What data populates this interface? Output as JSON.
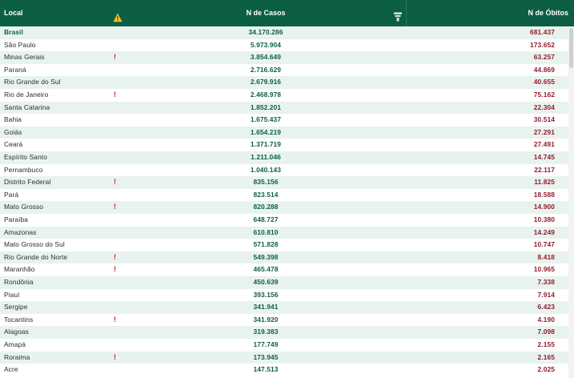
{
  "header": {
    "local_label": "Local",
    "casos_label": "N de Casos",
    "obitos_label": "N de Óbitos",
    "warn_icon": "warning-triangle-icon",
    "filter_icon": "filter-icon"
  },
  "colors": {
    "header_bg": "#0c5e45",
    "cases_text": "#0c5e45",
    "deaths_text": "#8f1d2c",
    "alert": "#d21f1f",
    "row_alt": "#e8f3ef"
  },
  "rows": [
    {
      "local": "Brasil",
      "alert": "",
      "casos": "34.170.286",
      "obitos": "681.437"
    },
    {
      "local": "São Paulo",
      "alert": "",
      "casos": "5.973.904",
      "obitos": "173.652"
    },
    {
      "local": "Minas Gerais",
      "alert": "!",
      "casos": "3.854.649",
      "obitos": "63.257"
    },
    {
      "local": "Paraná",
      "alert": "",
      "casos": "2.716.629",
      "obitos": "44.869"
    },
    {
      "local": "Rio Grande do Sul",
      "alert": "",
      "casos": "2.679.916",
      "obitos": "40.655"
    },
    {
      "local": "Rio de Janeiro",
      "alert": "!",
      "casos": "2.468.978",
      "obitos": "75.162"
    },
    {
      "local": "Santa Catarina",
      "alert": "",
      "casos": "1.852.201",
      "obitos": "22.304"
    },
    {
      "local": "Bahia",
      "alert": "",
      "casos": "1.675.437",
      "obitos": "30.514"
    },
    {
      "local": "Goiás",
      "alert": "",
      "casos": "1.654.219",
      "obitos": "27.291"
    },
    {
      "local": "Ceará",
      "alert": "",
      "casos": "1.371.719",
      "obitos": "27.491"
    },
    {
      "local": "Espírito Santo",
      "alert": "",
      "casos": "1.211.046",
      "obitos": "14.745"
    },
    {
      "local": "Pernambuco",
      "alert": "",
      "casos": "1.040.143",
      "obitos": "22.117"
    },
    {
      "local": "Distrito Federal",
      "alert": "!",
      "casos": "835.156",
      "obitos": "11.825"
    },
    {
      "local": "Pará",
      "alert": "",
      "casos": "823.514",
      "obitos": "18.588"
    },
    {
      "local": "Mato Grosso",
      "alert": "!",
      "casos": "820.288",
      "obitos": "14.900"
    },
    {
      "local": "Paraíba",
      "alert": "",
      "casos": "648.727",
      "obitos": "10.380"
    },
    {
      "local": "Amazonas",
      "alert": "",
      "casos": "610.810",
      "obitos": "14.249"
    },
    {
      "local": "Mato Grosso do Sul",
      "alert": "",
      "casos": "571.828",
      "obitos": "10.747"
    },
    {
      "local": "Rio Grande do Norte",
      "alert": "!",
      "casos": "549.398",
      "obitos": "8.418"
    },
    {
      "local": "Maranhão",
      "alert": "!",
      "casos": "465.478",
      "obitos": "10.965"
    },
    {
      "local": "Rondônia",
      "alert": "",
      "casos": "450.639",
      "obitos": "7.338"
    },
    {
      "local": "Piauí",
      "alert": "",
      "casos": "393.156",
      "obitos": "7.914"
    },
    {
      "local": "Sergipe",
      "alert": "",
      "casos": "341.941",
      "obitos": "6.423"
    },
    {
      "local": "Tocantins",
      "alert": "!",
      "casos": "341.920",
      "obitos": "4.190"
    },
    {
      "local": "Alagoas",
      "alert": "",
      "casos": "319.383",
      "obitos": "7.098"
    },
    {
      "local": "Amapá",
      "alert": "",
      "casos": "177.749",
      "obitos": "2.155"
    },
    {
      "local": "Roraima",
      "alert": "!",
      "casos": "173.945",
      "obitos": "2.165"
    },
    {
      "local": "Acre",
      "alert": "",
      "casos": "147.513",
      "obitos": "2.025"
    }
  ]
}
